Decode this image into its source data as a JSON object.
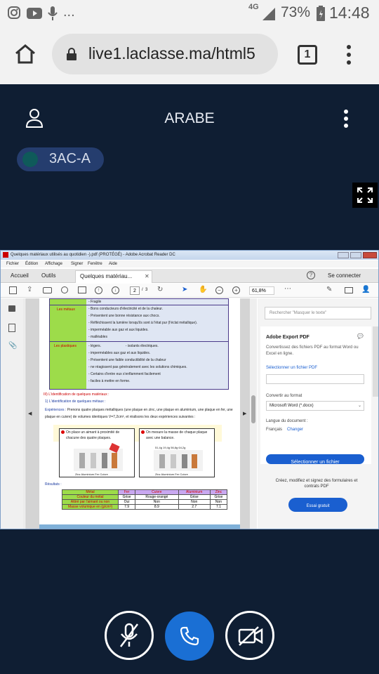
{
  "status": {
    "time": "14:48",
    "battery": "73%",
    "network": "4G",
    "notif_dots": "..."
  },
  "browser": {
    "url": "live1.laclasse.ma/html5",
    "tab_count": "1"
  },
  "app": {
    "room_title": "ARABE",
    "class_badge": "3AC-A"
  },
  "acrobat": {
    "window_title": "Quelques matériaux utilisés au quotidien -).pdf (PROTÉGÉ) - Adobe Acrobat Reader DC",
    "menu": [
      "Fichier",
      "Édition",
      "Affichage",
      "Signer",
      "Fenêtre",
      "Aide"
    ],
    "tabs": [
      "Accueil",
      "Outils",
      "Quelques matériau..."
    ],
    "connect": "Se connecter",
    "page_current": "2",
    "page_sep": "/",
    "page_total": "3",
    "zoom": "61,8%",
    "right_search_placeholder": "Rechercher \"Masquer le texte\"",
    "export": {
      "title": "Adobe Export PDF",
      "desc": "Convertissez des fichiers PDF au format Word ou Excel en ligne.",
      "select_link": "Sélectionner un fichier PDF",
      "convert_label": "Convertir au format",
      "format": "Microsoft Word (*.docx)",
      "lang_label": "Langue du document :",
      "lang_value": "Français",
      "lang_change": "Changer",
      "select_btn": "Sélectionner un fichier",
      "promo": "Créez, modifiez et signez des formulaires et contrats PDF",
      "trial_btn": "Essai gratuit"
    }
  },
  "doc": {
    "fragile": "- Fragile",
    "metaux_label": "Les métaux",
    "metaux_lines": [
      "- Bons conducteurs d'électricité et de la chaleur.",
      "- Présentent une bonne résistance aux chocs.",
      "- Réfléchissent la lumière lorsqu'ils sont à l'état pur (l'éclat métallique).",
      "- imperméable aux gaz et aux liquides.",
      "- malléables"
    ],
    "plastiques_label": "Les plastiques",
    "plastiques_lines": [
      "- légers.                         - isolants électriques.",
      "- imperméables aux gaz et aux liquides.",
      "- Présentent une faible conductibilité de la chaleur",
      "- ne réagissent pas généralement avec les solutions chimiques.",
      "- Certains d'entre eux s'enflamment facilement",
      "- faciles à mettre en forme."
    ],
    "section_title": "III) L'identification de quelques matériaux :",
    "sub_title": "1) L'identification de quelques métaux :",
    "exp_label": "Expériences :",
    "exp_text": "Prenons quatre plaques métalliques (une plaque en zinc, une plaque en aluminium, une plaque en fer, une plaque en cuivre) de volumes identiques V=7,2cm³, et réalisons les deux expériences suivantes :",
    "box1": "On place un aimant à proximité de chacune des quatre plaques.",
    "box2": "On mesure la masse de chaque plaque avec une balance.",
    "box1_caption": "Zinc  Aluminium  Fer  Cuivre",
    "box2_caption": "Zinc  Aluminium  Fer  Cuivre",
    "box2_masses": "51,4g  19,4g  56,8g  64,2g",
    "results_label": "Résultats :",
    "table_header": [
      "Métal",
      "Fer",
      "Cuivre",
      "Aluminium",
      "Zinc"
    ],
    "table_rows": [
      [
        "Couleur du métal",
        "Grise",
        "Rouge-orangé",
        "Grise",
        "Grise"
      ],
      [
        "Attiré par l'aimant ou non",
        "Oui",
        "Non",
        "Non",
        "Non"
      ],
      [
        "Masse volumique en (g/cm³)",
        "7.9",
        "8.9",
        "2.7",
        "7.1"
      ]
    ]
  }
}
